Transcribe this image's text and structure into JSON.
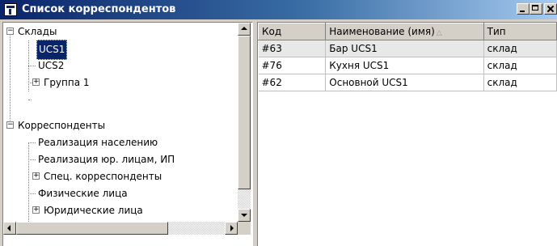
{
  "window": {
    "title": "Список корреспондентов"
  },
  "tree": {
    "nodes": [
      {
        "label": "Склады",
        "expander": "−"
      },
      {
        "label": "UCS1",
        "selected": true
      },
      {
        "label": "UCS2"
      },
      {
        "label": "Группа 1",
        "expander": "+"
      },
      {
        "label": "Корреспонденты",
        "expander": "−"
      },
      {
        "label": "Реализация населению"
      },
      {
        "label": "Реализация юр. лицам, ИП"
      },
      {
        "label": "Спец. корреспонденты",
        "expander": "+"
      },
      {
        "label": "Физические лица"
      },
      {
        "label": "Юридические лица",
        "expander": "+"
      }
    ]
  },
  "grid": {
    "columns": [
      "Код",
      "Наименование (имя)",
      "Тип"
    ],
    "sort_indicator": "△",
    "rows": [
      [
        "#63",
        "Бар UCS1",
        "склад"
      ],
      [
        "#76",
        "Кухня UCS1",
        "склад"
      ],
      [
        "#62",
        "Основной UCS1",
        "склад"
      ]
    ]
  }
}
